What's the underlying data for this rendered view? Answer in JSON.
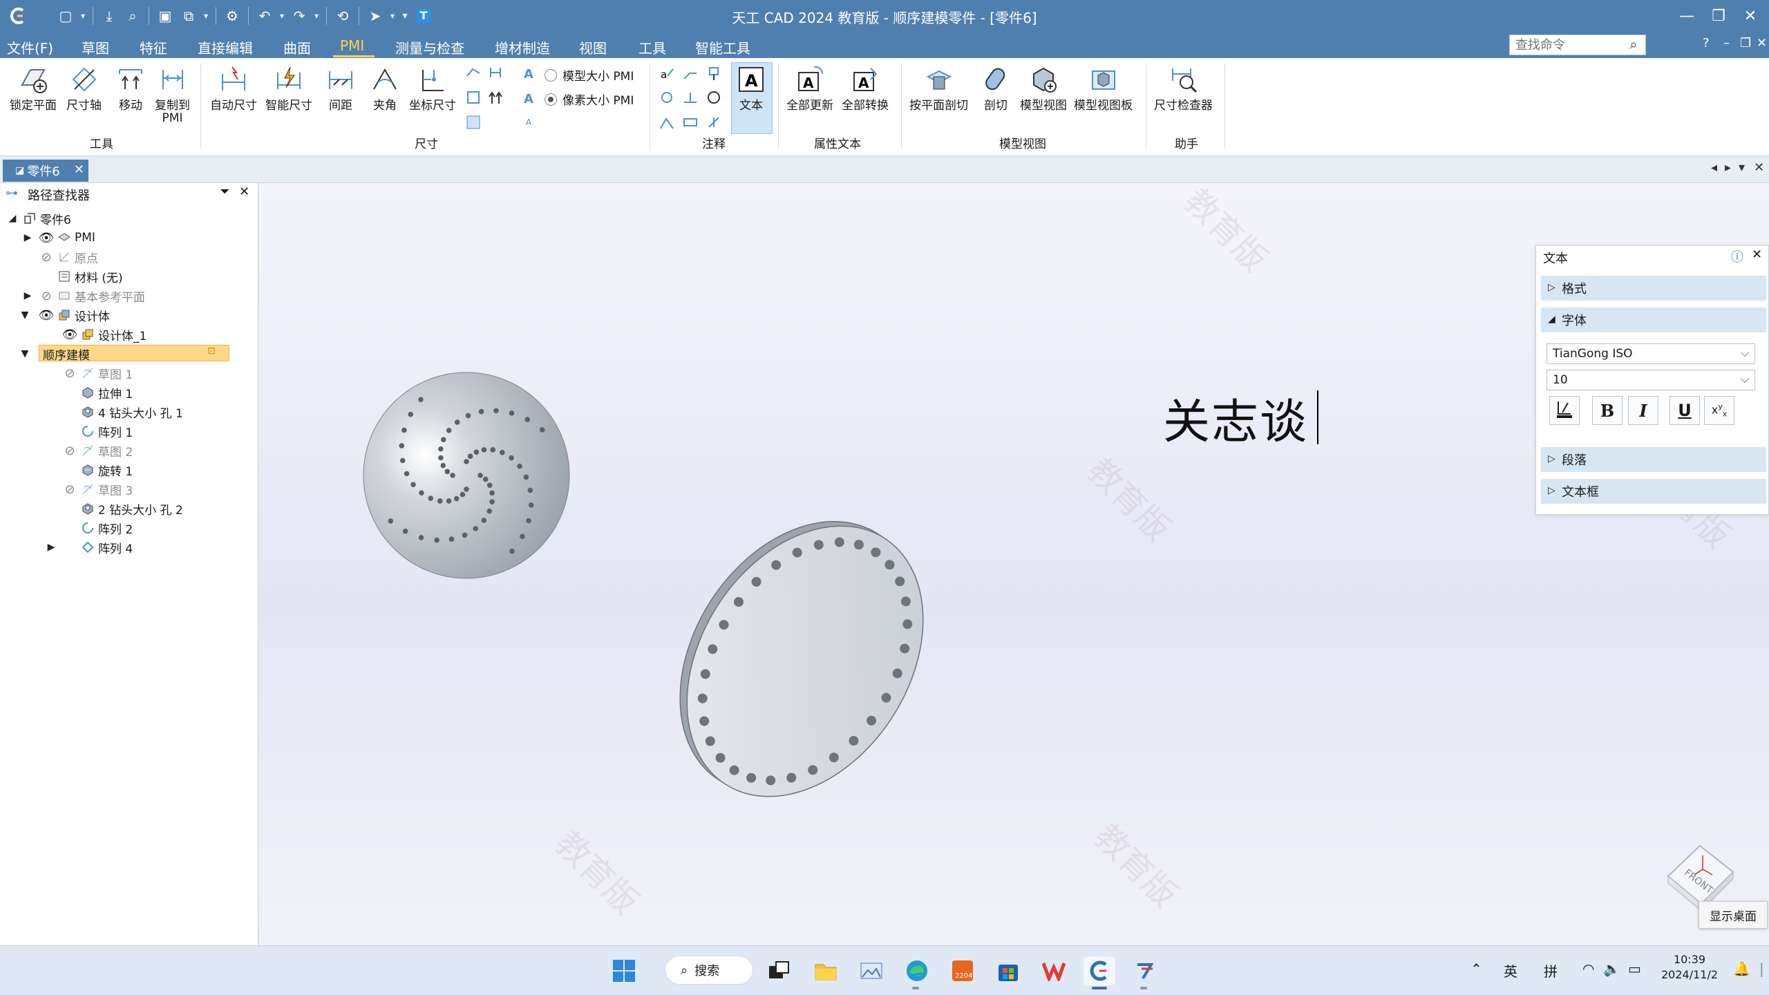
{
  "app": {
    "title": "天工 CAD 2024 教育版 - 顺序建模零件 - [零件6]"
  },
  "menu": {
    "items": [
      "文件(F)",
      "草图",
      "特征",
      "直接编辑",
      "曲面",
      "PMI",
      "测量与检查",
      "增材制造",
      "视图",
      "工具",
      "智能工具"
    ],
    "active": "PMI",
    "search_placeholder": "查找命令",
    "help": "?"
  },
  "ribbon": {
    "tools": {
      "group_label": "工具",
      "lock_plane": "锁定平面",
      "dim_axis": "尺寸轴",
      "move": "移动",
      "copy_to_pmi_1": "复制到",
      "copy_to_pmi_2": "PMI"
    },
    "dimension": {
      "group_label": "尺寸",
      "auto_dim": "自动尺寸",
      "smart_dim": "智能尺寸",
      "distance": "间距",
      "angle": "夹角",
      "coord_dim": "坐标尺寸"
    },
    "pmi_size": {
      "model_size": "模型大小 PMI",
      "pixel_size": "像素大小 PMI",
      "selected": "pixel_size"
    },
    "annotation": {
      "group_label": "注释",
      "text": "文本"
    },
    "attr_text": {
      "group_label": "属性文本",
      "update_all": "全部更新",
      "convert_all": "全部转换"
    },
    "model_view": {
      "group_label": "模型视图",
      "plane_cut": "按平面剖切",
      "section": "剖切",
      "model_view": "模型视图",
      "model_view_board": "模型视图板"
    },
    "assistant": {
      "group_label": "助手",
      "dim_checker": "尺寸检查器"
    }
  },
  "doc_tab": {
    "label": "零件6",
    "close": "✕"
  },
  "path_finder": {
    "title": "路径查找器",
    "tree": [
      {
        "label": "零件6"
      },
      {
        "label": "PMI"
      },
      {
        "label": "原点"
      },
      {
        "label": "材料 (无)"
      },
      {
        "label": "基本参考平面"
      },
      {
        "label": "设计体"
      },
      {
        "label": "设计体_1"
      },
      {
        "label": "顺序建模"
      },
      {
        "label": "草图 1"
      },
      {
        "label": "拉伸 1"
      },
      {
        "label": "4 钻头大小 孔 1"
      },
      {
        "label": "阵列 1"
      },
      {
        "label": "草图 2"
      },
      {
        "label": "旋转 1"
      },
      {
        "label": "草图 3"
      },
      {
        "label": "2 钻头大小 孔 2"
      },
      {
        "label": "阵列 2"
      },
      {
        "label": "阵列 4"
      }
    ]
  },
  "canvas": {
    "pmi_text": "关志谈",
    "watermark": "教育版",
    "view_cube_label": "FRONT"
  },
  "text_panel": {
    "title": "文本",
    "sections": {
      "format": "格式",
      "font": "字体",
      "paragraph": "段落",
      "textbox": "文本框"
    },
    "font_name": "TianGong ISO",
    "font_size": "10",
    "bold": "B",
    "italic": "I",
    "underline": "U"
  },
  "tooltip": {
    "show_desktop": "显示桌面"
  },
  "taskbar": {
    "search": "搜索",
    "ime_lang": "英",
    "ime_mode": "拼",
    "time": "10:39",
    "date": "2024/11/2"
  },
  "colors": {
    "title_bar": "#4f7fae",
    "menu_active": "#ffd34d",
    "section_header": "#d7e6f3",
    "tree_highlight": "#ffd98a"
  }
}
